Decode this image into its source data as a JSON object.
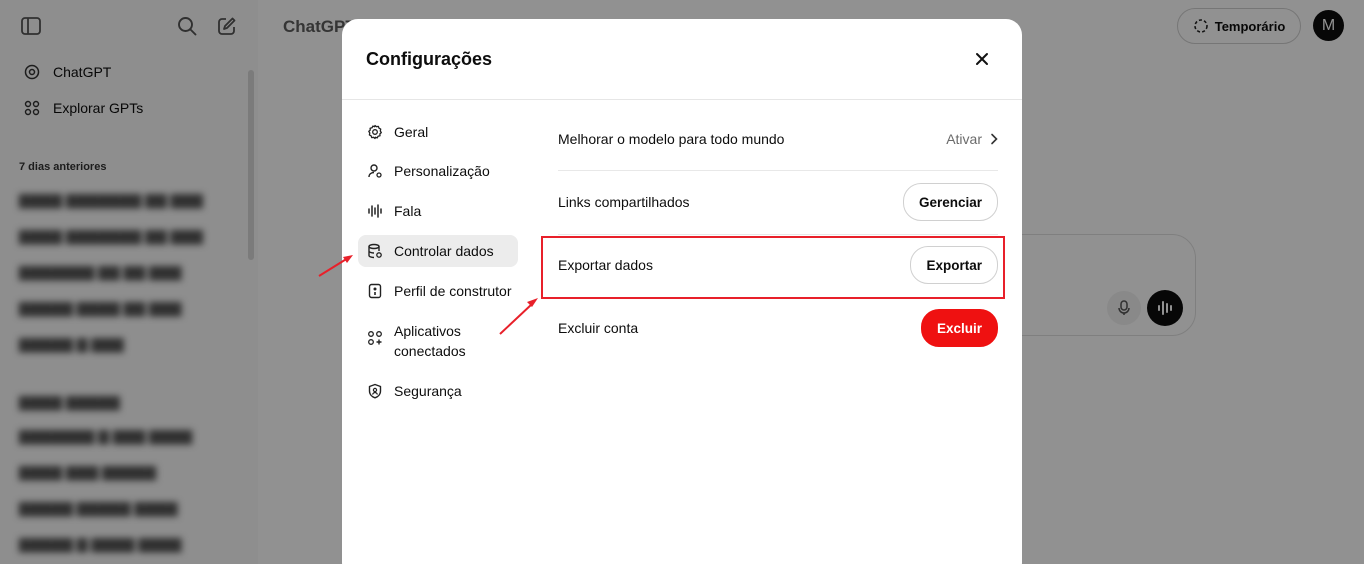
{
  "sidebar": {
    "nav": [
      {
        "label": "ChatGPT",
        "icon": "openai-logo-icon"
      },
      {
        "label": "Explorar GPTs",
        "icon": "grid-icon"
      }
    ],
    "section_label": "7 dias anteriores"
  },
  "main": {
    "title": "ChatGPT",
    "temporary_label": "Temporário",
    "avatar_initial": "M"
  },
  "modal": {
    "title": "Configurações",
    "nav": [
      {
        "label": "Geral",
        "icon": "gear-icon"
      },
      {
        "label": "Personalização",
        "icon": "person-icon"
      },
      {
        "label": "Fala",
        "icon": "waveform-icon"
      },
      {
        "label": "Controlar dados",
        "icon": "database-icon",
        "active": true
      },
      {
        "label": "Perfil de construtor",
        "icon": "builder-icon"
      },
      {
        "label": "Aplicativos\nconectados",
        "icon": "apps-icon"
      },
      {
        "label": "Segurança",
        "icon": "shield-icon"
      }
    ],
    "rows": [
      {
        "label": "Melhorar o modelo para todo mundo",
        "action": "Ativar"
      },
      {
        "label": "Links compartilhados",
        "action": "Gerenciar"
      },
      {
        "label": "Exportar dados",
        "action": "Exportar"
      },
      {
        "label": "Excluir conta",
        "action": "Excluir"
      }
    ]
  },
  "colors": {
    "accent_danger": "#ef1111",
    "annotation": "#e8202a",
    "active_nav": "#ececec"
  }
}
